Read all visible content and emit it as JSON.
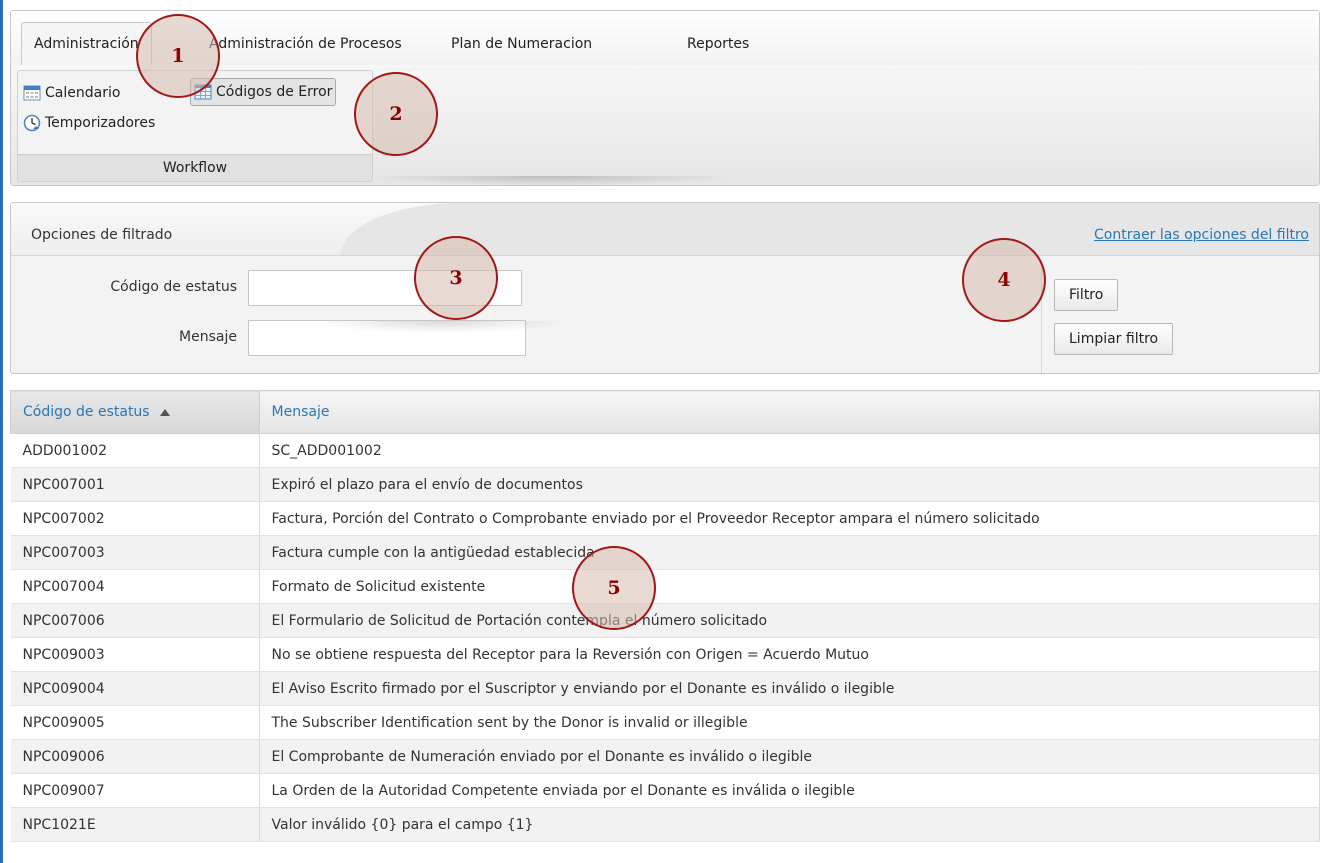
{
  "tabs": [
    {
      "label": "Administración",
      "active": true
    },
    {
      "label": "Administración de Procesos"
    },
    {
      "label": "Plan de Numeracion"
    },
    {
      "label": "Reportes"
    }
  ],
  "ribbon": {
    "group_label": "Workflow",
    "buttons": [
      {
        "label": "Calendario",
        "icon": "calendar-icon"
      },
      {
        "label": "Códigos de Error",
        "icon": "grid-table-icon",
        "selected": true
      },
      {
        "label": "Temporizadores",
        "icon": "clock-icon"
      }
    ]
  },
  "filter": {
    "title": "Opciones de filtrado",
    "collapse_link": "Contraer las opciones del filtro",
    "fields": [
      {
        "label": "Código de estatus",
        "value": "",
        "placeholder": ""
      },
      {
        "label": "Mensaje",
        "value": "",
        "placeholder": ""
      }
    ],
    "filter_button": "Filtro",
    "clear_button": "Limpiar filtro"
  },
  "grid": {
    "columns": [
      "Código de estatus",
      "Mensaje"
    ],
    "sorted_column": "Código de estatus",
    "sort_direction": "ascending",
    "rows": [
      [
        "ADD001002",
        "SC_ADD001002"
      ],
      [
        "NPC007001",
        "Expiró el plazo para el envío de documentos"
      ],
      [
        "NPC007002",
        "Factura, Porción del Contrato o Comprobante enviado por el Proveedor Receptor ampara el número solicitado"
      ],
      [
        "NPC007003",
        "Factura cumple con la antigüedad establecida"
      ],
      [
        "NPC007004",
        "Formato de Solicitud existente"
      ],
      [
        "NPC007006",
        "El Formulario de Solicitud de Portación contempla el número solicitado"
      ],
      [
        "NPC009003",
        "No se obtiene respuesta del Receptor para la Reversión con Origen = Acuerdo Mutuo"
      ],
      [
        "NPC009004",
        "El Aviso Escrito firmado por el Suscriptor y enviando por el Donante es inválido o ilegible"
      ],
      [
        "NPC009005",
        "The Subscriber Identification sent by the Donor is invalid or illegible"
      ],
      [
        "NPC009006",
        "El Comprobante de Numeración enviado por el Donante es inválido o ilegible"
      ],
      [
        "NPC009007",
        "La Orden de la Autoridad Competente enviada por el Donante es inválida o ilegible"
      ],
      [
        "NPC1021E",
        "Valor inválido {0} para el campo {1}"
      ]
    ]
  },
  "callouts": [
    "1",
    "2",
    "3",
    "4",
    "5"
  ],
  "colors": {
    "link": "#2a77b8",
    "callout_border": "#a01818",
    "callout_text": "#8b0000"
  }
}
